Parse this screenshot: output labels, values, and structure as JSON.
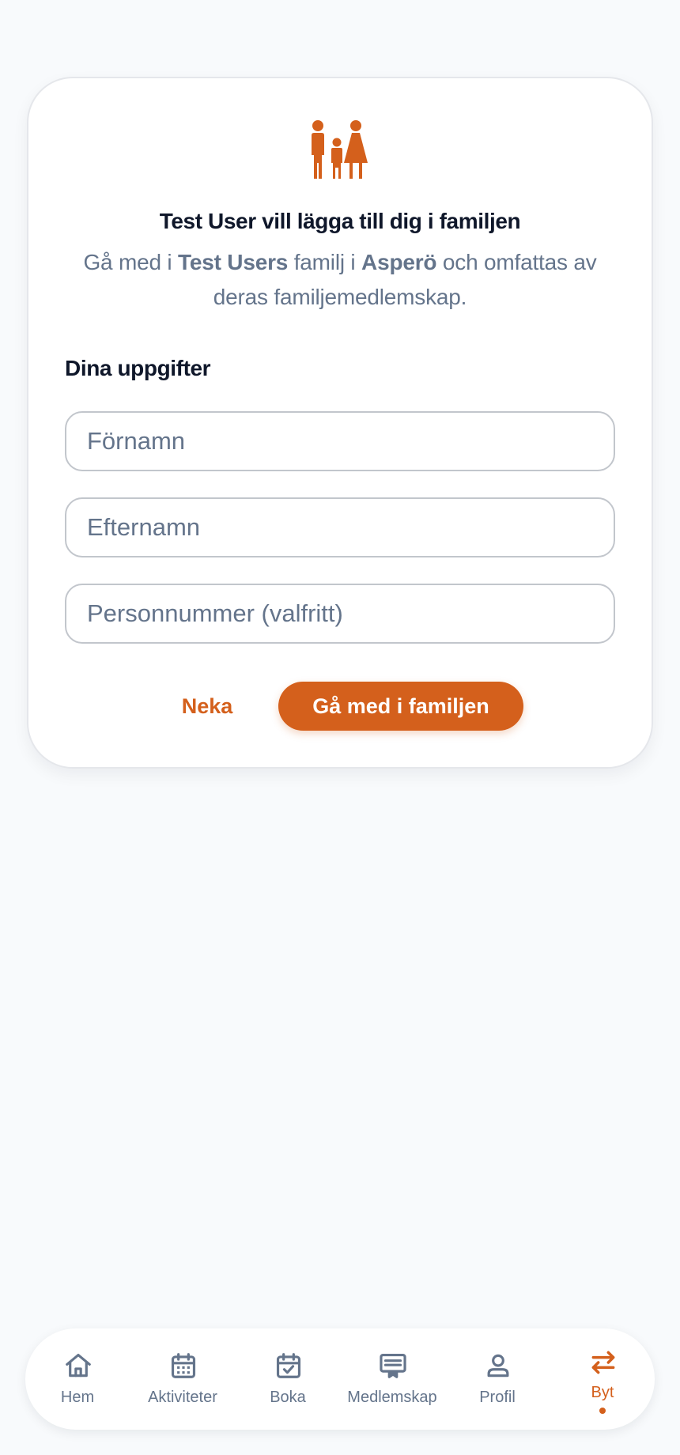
{
  "invite": {
    "title": "Test User vill lägga till dig i familjen",
    "subtitle": {
      "part1": "Gå med i ",
      "inviter": "Test Users",
      "part2": " familj i ",
      "club": "Asperö",
      "part3": " och omfattas av deras familjemedlemskap."
    }
  },
  "form": {
    "section_label": "Dina uppgifter",
    "first_name_placeholder": "Förnamn",
    "last_name_placeholder": "Efternamn",
    "personal_number_placeholder": "Personnummer (valfritt)"
  },
  "actions": {
    "decline_label": "Neka",
    "join_label": "Gå med i familjen"
  },
  "bottom_nav": {
    "items": [
      {
        "label": "Hem",
        "icon": "home-icon"
      },
      {
        "label": "Aktiviteter",
        "icon": "calendar-icon"
      },
      {
        "label": "Boka",
        "icon": "calendar-check-icon"
      },
      {
        "label": "Medlemskap",
        "icon": "membership-card-icon"
      },
      {
        "label": "Profil",
        "icon": "person-icon"
      },
      {
        "label": "Byt",
        "icon": "swap-arrows-icon",
        "active": true
      }
    ]
  },
  "colors": {
    "accent": "#d4601c",
    "text_primary": "#0f172a",
    "text_secondary": "#64748b",
    "background": "#f8fafc"
  }
}
